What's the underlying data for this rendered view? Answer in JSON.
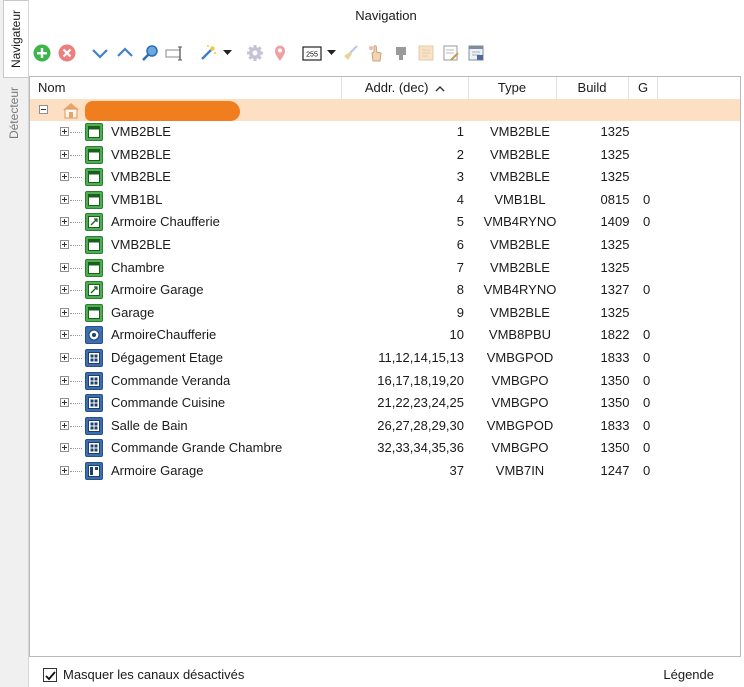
{
  "tabs": [
    {
      "label": "Navigateur",
      "active": true
    },
    {
      "label": "Détecteur",
      "active": false
    }
  ],
  "panel_title": "Navigation",
  "toolbar": {
    "dropdown_value": "255",
    "colors": {
      "add": "#3db54a",
      "remove": "#e86b6b",
      "arrow": "#3f82c7"
    }
  },
  "columns": {
    "name": "Nom",
    "addr": "Addr. (dec)",
    "type": "Type",
    "build": "Build",
    "g": "G"
  },
  "rows": [
    {
      "name": "VMB2BLE",
      "addr": "1",
      "type": "VMB2BLE",
      "build": "1325",
      "g": "",
      "icon": "window-icon",
      "color": "green"
    },
    {
      "name": "VMB2BLE",
      "addr": "2",
      "type": "VMB2BLE",
      "build": "1325",
      "g": "",
      "icon": "window-icon",
      "color": "green"
    },
    {
      "name": "VMB2BLE",
      "addr": "3",
      "type": "VMB2BLE",
      "build": "1325",
      "g": "",
      "icon": "window-icon",
      "color": "green"
    },
    {
      "name": "VMB1BL",
      "addr": "4",
      "type": "VMB1BL",
      "build": "0815",
      "g": "0",
      "icon": "window-icon",
      "color": "green"
    },
    {
      "name": "Armoire Chaufferie",
      "addr": "5",
      "type": "VMB4RYNO",
      "build": "1409",
      "g": "0",
      "icon": "relay-icon",
      "color": "green"
    },
    {
      "name": "VMB2BLE",
      "addr": "6",
      "type": "VMB2BLE",
      "build": "1325",
      "g": "",
      "icon": "window-icon",
      "color": "green"
    },
    {
      "name": "Chambre",
      "addr": "7",
      "type": "VMB2BLE",
      "build": "1325",
      "g": "",
      "icon": "window-icon",
      "color": "green"
    },
    {
      "name": "Armoire Garage",
      "addr": "8",
      "type": "VMB4RYNO",
      "build": "1327",
      "g": "0",
      "icon": "relay-icon",
      "color": "green"
    },
    {
      "name": "Garage",
      "addr": "9",
      "type": "VMB2BLE",
      "build": "1325",
      "g": "",
      "icon": "window-icon",
      "color": "green"
    },
    {
      "name": "ArmoireChaufferie",
      "addr": "10",
      "type": "VMB8PBU",
      "build": "1822",
      "g": "0",
      "icon": "pushbutton-icon",
      "color": "blue"
    },
    {
      "name": "Dégagement Etage",
      "addr": "11,12,14,15,13",
      "type": "VMBGPOD",
      "build": "1833",
      "g": "0",
      "icon": "glass-panel-icon",
      "color": "blue"
    },
    {
      "name": "Commande Veranda",
      "addr": "16,17,18,19,20",
      "type": "VMBGPO",
      "build": "1350",
      "g": "0",
      "icon": "glass-panel-icon",
      "color": "blue"
    },
    {
      "name": "Commande Cuisine",
      "addr": "21,22,23,24,25",
      "type": "VMBGPO",
      "build": "1350",
      "g": "0",
      "icon": "glass-panel-icon",
      "color": "blue"
    },
    {
      "name": "Salle de Bain",
      "addr": "26,27,28,29,30",
      "type": "VMBGPOD",
      "build": "1833",
      "g": "0",
      "icon": "glass-panel-icon",
      "color": "blue"
    },
    {
      "name": "Commande Grande  Chambre",
      "addr": "32,33,34,35,36",
      "type": "VMBGPO",
      "build": "1350",
      "g": "0",
      "icon": "glass-panel-icon",
      "color": "blue"
    },
    {
      "name": "Armoire Garage",
      "addr": "37",
      "type": "VMB7IN",
      "build": "1247",
      "g": "0",
      "icon": "input-module-icon",
      "color": "blue"
    }
  ],
  "footer": {
    "hide_disabled_label": "Masquer les canaux désactivés",
    "hide_disabled_checked": true,
    "legend_label": "Légende"
  }
}
